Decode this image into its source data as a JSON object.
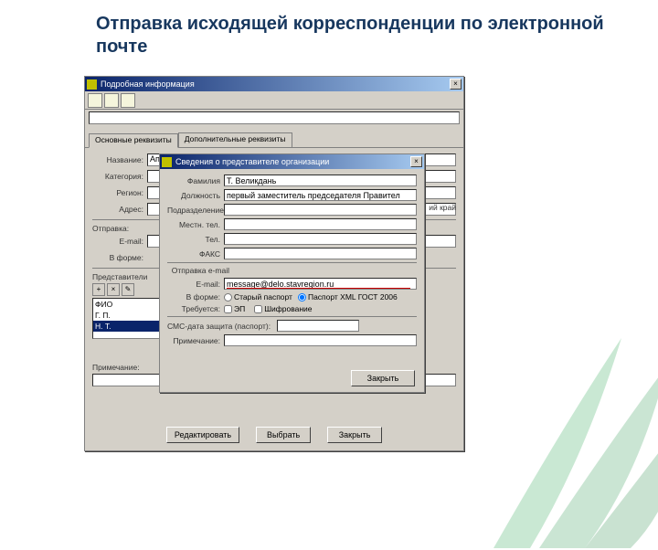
{
  "slide": {
    "title": "Отправка исходящей корреспонденции по электронной почте"
  },
  "parent": {
    "title": "Подробная информация",
    "tabs": {
      "t1": "Основные реквизиты",
      "t2": "Дополнительные реквизиты"
    },
    "labels": {
      "nazvanie": "Название:",
      "kategoria": "Категория:",
      "region": "Регион:",
      "adres": "Адрес:",
      "otpravka": "Отправка:",
      "email": "E-mail:",
      "vforme": "В форме:",
      "predstaviteli": "Представители",
      "primechanie": "Примечание:"
    },
    "values": {
      "nazvanie": "Аппарат Правительства Ставропольского края",
      "region_suffix": "ий край"
    },
    "list": {
      "item1": "ФИО",
      "item2": "Г. П.",
      "item3": "Н. Т."
    },
    "buttons": {
      "edit": "Редактировать",
      "vybrat": "Выбрать",
      "close": "Закрыть"
    }
  },
  "child": {
    "title": "Сведения о представителе организации",
    "labels": {
      "familia": "Фамилия",
      "dolzhnost": "Должность",
      "podrazd": "Подразделение",
      "mesttel": "Местн. тел.",
      "tel": "Тел.",
      "fax": "ФАКС",
      "otpravka": "Отправка e-mail",
      "email": "E-mail:",
      "vforme": "В форме:",
      "trebuetsya": "Требуется:",
      "smsdata": "СМС-дата защита (паспорт):",
      "primech": "Примечание:"
    },
    "values": {
      "familia": "Т. Великдань",
      "dolzhnost": "первый заместитель председателя Правител",
      "email": "message@delo.stavregion.ru"
    },
    "radios": {
      "old": "Старый паспорт",
      "xml": "Паспорт XML ГОСТ 2006"
    },
    "checks": {
      "ep": "ЭП",
      "shifr": "Шифрование"
    },
    "button": {
      "close": "Закрыть"
    }
  }
}
